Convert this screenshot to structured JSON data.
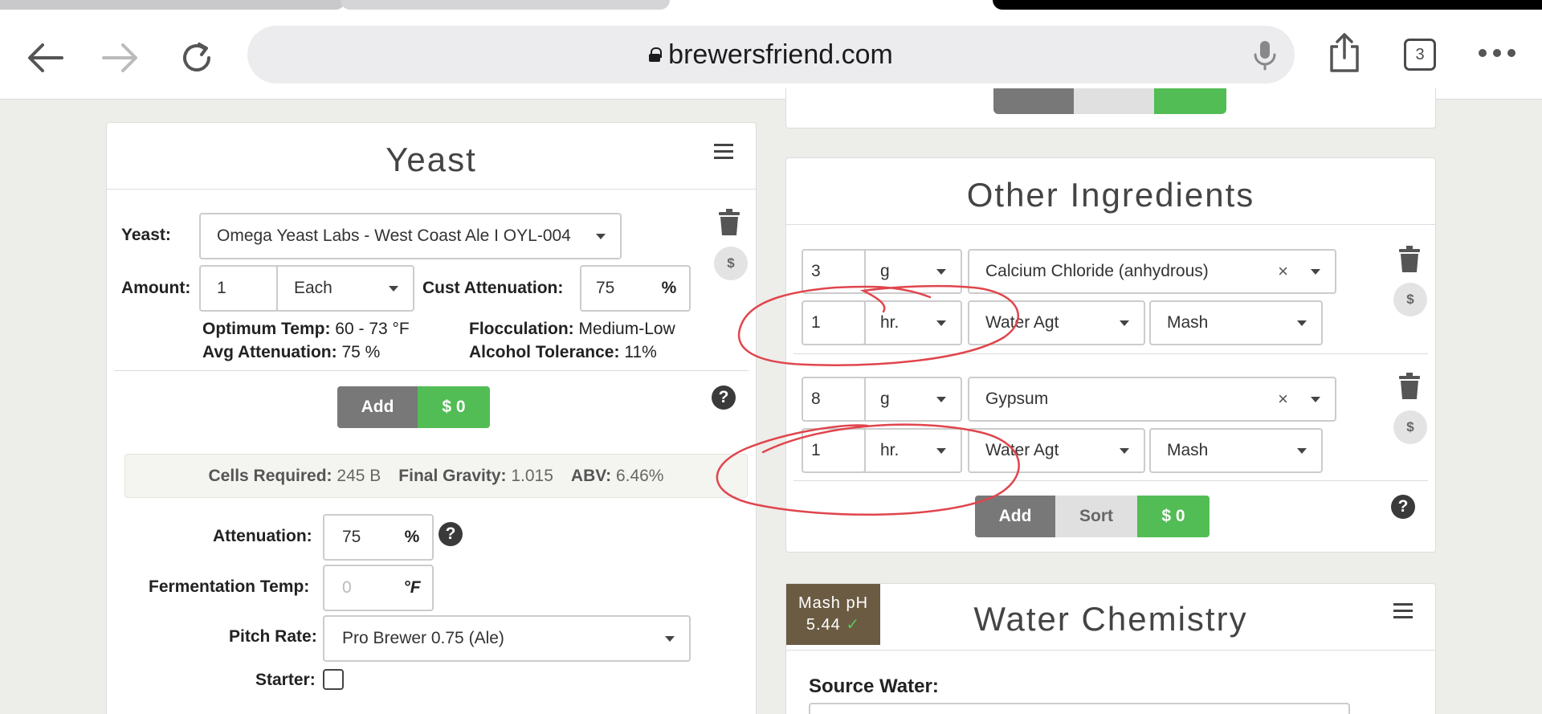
{
  "browser": {
    "url": "brewersfriend.com",
    "tab_count": "3"
  },
  "yeast_panel": {
    "title": "Yeast",
    "yeast_label": "Yeast:",
    "yeast_value": "Omega Yeast Labs - West Coast Ale I OYL-004",
    "amount_label": "Amount:",
    "amount_value": "1",
    "amount_unit": "Each",
    "cust_atten_label": "Cust Attenuation:",
    "cust_atten_value": "75",
    "percent": "%",
    "optimum_temp_label": "Optimum Temp:",
    "optimum_temp_value": "60 - 73 °F",
    "avg_atten_label": "Avg Attenuation:",
    "avg_atten_value": "75 %",
    "flocculation_label": "Flocculation:",
    "flocculation_value": "Medium-Low",
    "alcohol_tol_label": "Alcohol Tolerance:",
    "alcohol_tol_value": "11%",
    "add_label": "Add",
    "cost_label": "$ 0",
    "dollar_label": "$",
    "help_label": "?",
    "cells_label": "Cells Required:",
    "cells_value": "245 B",
    "fg_label": "Final Gravity:",
    "fg_value": "1.015",
    "abv_label": "ABV:",
    "abv_value": "6.46%",
    "attenuation_label": "Attenuation:",
    "attenuation_value": "75",
    "ferm_temp_label": "Fermentation Temp:",
    "ferm_temp_placeholder": "0",
    "ferm_temp_unit": "°F",
    "pitch_rate_label": "Pitch Rate:",
    "pitch_rate_value": "Pro Brewer 0.75 (Ale)",
    "starter_label": "Starter:"
  },
  "other_ingredients": {
    "title": "Other Ingredients",
    "items": [
      {
        "amount": "3",
        "unit": "g",
        "name": "Calcium Chloride (anhydrous)",
        "time": "1",
        "time_unit": "hr.",
        "type": "Water Agt",
        "use": "Mash"
      },
      {
        "amount": "8",
        "unit": "g",
        "name": "Gypsum",
        "time": "1",
        "time_unit": "hr.",
        "type": "Water Agt",
        "use": "Mash"
      }
    ],
    "clear_symbol": "×",
    "dollar_label": "$",
    "add_label": "Add",
    "sort_label": "Sort",
    "cost_label": "$ 0",
    "help_label": "?"
  },
  "water_chemistry": {
    "title": "Water Chemistry",
    "mash_ph_label": "Mash pH",
    "mash_ph_value": "5.44",
    "mash_ph_check": "✓",
    "source_water_label": "Source Water:"
  },
  "colors": {
    "green": "#52bd55",
    "grey_button": "#787878",
    "mash_ph_bg": "#6b5b43",
    "annotation_red": "#e0454d"
  }
}
